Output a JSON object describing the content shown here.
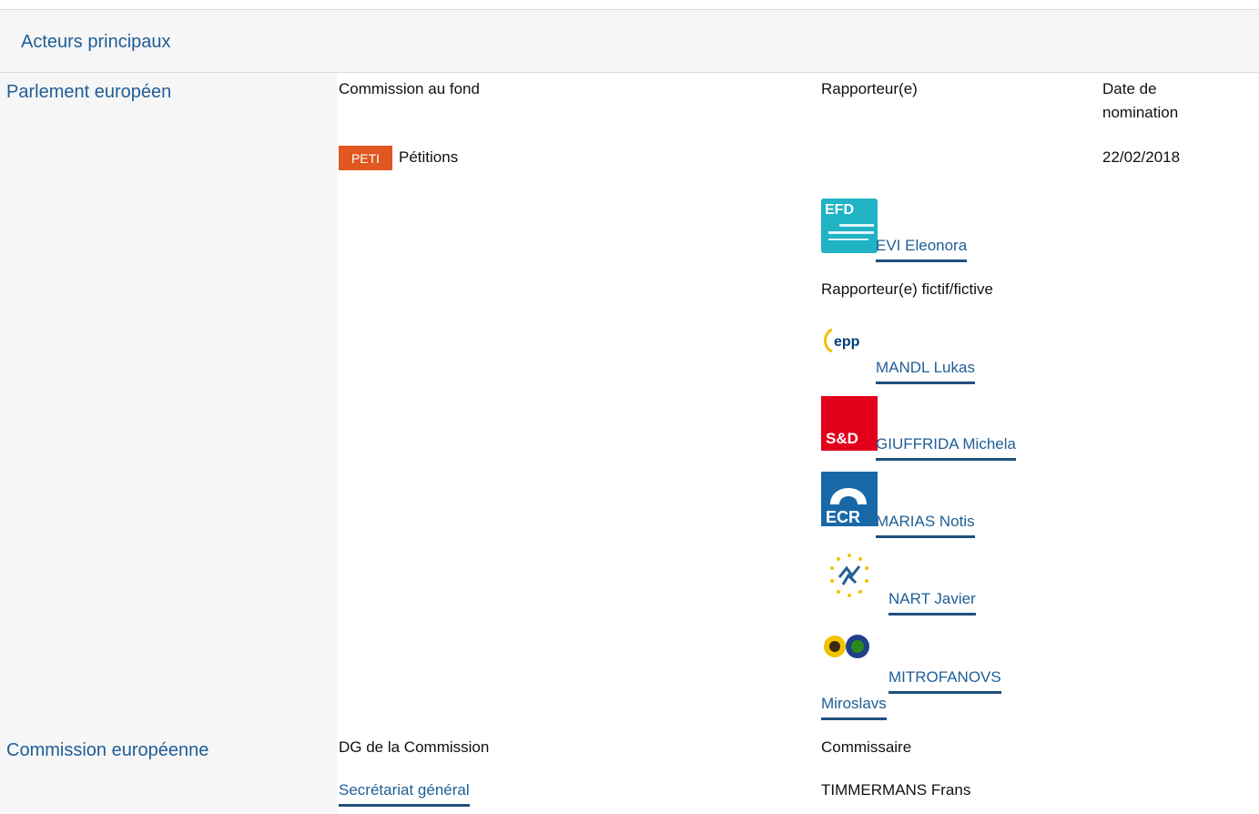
{
  "header": {
    "title": "Acteurs principaux"
  },
  "parliament": {
    "label": "Parlement européen",
    "col_committee": "Commission au fond",
    "col_rapporteur": "Rapporteur(e)",
    "col_date": "Date de nomination",
    "committee_code": "PETI",
    "committee_name": "Pétitions",
    "date": "22/02/2018",
    "rapporteur": {
      "name": "EVI Eleonora",
      "logo_text": "EFD"
    },
    "shadow_label": "Rapporteur(e) fictif/fictive",
    "shadows": [
      {
        "name": "MANDL Lukas",
        "logo_text": "epp"
      },
      {
        "name": "GIUFFRIDA Michela",
        "logo_text": "S&D"
      },
      {
        "name": "MARIAS Notis",
        "logo_text": "ECR"
      },
      {
        "name": "NART Javier",
        "logo_text": ""
      },
      {
        "name_line1": "MITROFANOVS",
        "name_line2": "Miroslavs",
        "logo_text": ""
      }
    ]
  },
  "commission": {
    "label": "Commission européenne",
    "col_dg": "DG de la Commission",
    "col_commissioner": "Commissaire",
    "dg": "Secrétariat général",
    "commissioner": "TIMMERMANS Frans"
  },
  "colors": {
    "accent": "#1f5e96",
    "badge": "#e0571f",
    "efd": "#1fb3c4",
    "sd": "#e3001b",
    "ecr": "#1868a8",
    "epp": "#003d7a",
    "alde_stars": "#f2c200",
    "greens": "#2b8a1d"
  }
}
